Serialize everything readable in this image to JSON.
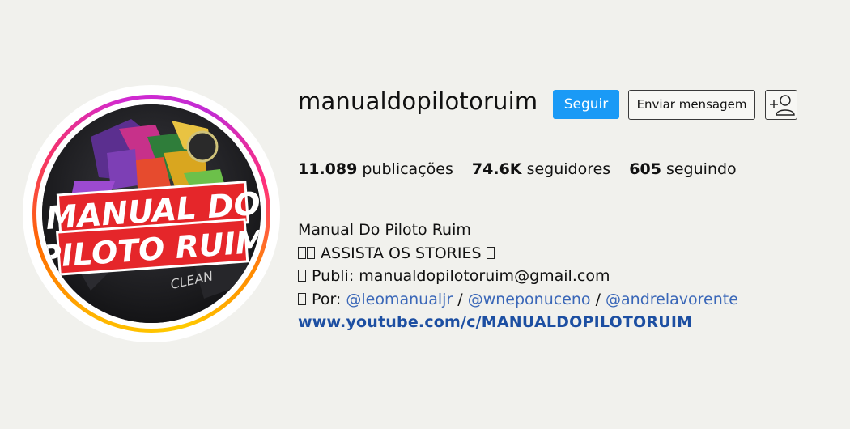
{
  "profile": {
    "username": "manualdopilotoruim",
    "avatar_logo_line1": "MANUAL DO",
    "avatar_logo_line2": "PILOTO RUIM",
    "avatar_logo_small": "CLEAN"
  },
  "actions": {
    "follow_label": "Seguir",
    "message_label": "Enviar mensagem",
    "add_user_icon": "person-plus-icon"
  },
  "stats": [
    {
      "value": "11.089",
      "label": "publicações"
    },
    {
      "value": "74.6K",
      "label": "seguidores"
    },
    {
      "value": "605",
      "label": "seguindo"
    }
  ],
  "bio": {
    "name": "Manual Do Piloto Ruim",
    "line1_text": " ASSISTA OS STORIES ",
    "line2_text": " Publi: manualdopilotoruim@gmail.com",
    "line3_prefix": " Por: ",
    "mentions": [
      "@leomanualjr",
      "@wneponuceno",
      "@andrelavorente"
    ],
    "separator": " / ",
    "website": "www.youtube.com/c/MANUALDOPILOTORUIM"
  },
  "colors": {
    "background": "#f1f1ed",
    "follow_button": "#1a9af6",
    "mention": "#3a67b8",
    "website": "#1d4fa2",
    "logo_red": "#e5262a"
  }
}
